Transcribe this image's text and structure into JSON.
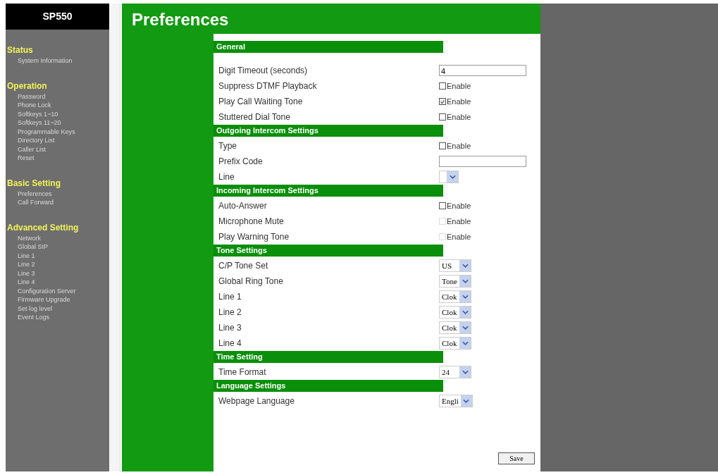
{
  "sidebar": {
    "logo": "SP550",
    "groups": [
      {
        "title": "Status",
        "items": [
          "System Information"
        ]
      },
      {
        "title": "Operation",
        "items": [
          "Password",
          "Phone Lock",
          "Softkeys 1~10",
          "Softkeys 11~20",
          "Programmable Keys",
          "Directory List",
          "Caller List",
          "Reset"
        ]
      },
      {
        "title": "Basic Setting",
        "items": [
          "Preferences",
          "Call Forward"
        ]
      },
      {
        "title": "Advanced Setting",
        "items": [
          "Network",
          "Global SIP",
          "Line 1",
          "Line 2",
          "Line 3",
          "Line 4",
          "Configuration Server",
          "Firmware Upgrade",
          "Set log level",
          "Event Logs"
        ]
      }
    ]
  },
  "page": {
    "title": "Preferences"
  },
  "sections": [
    {
      "title": "General",
      "rows": [
        {
          "kind": "text",
          "label": "Digit Timeout (seconds)",
          "value": "4"
        },
        {
          "kind": "checkbox",
          "label": "Suppress DTMF Playback",
          "option": "Enable",
          "checked": false,
          "disabled": false
        },
        {
          "kind": "checkbox",
          "label": "Play Call Waiting Tone",
          "option": "Enable",
          "checked": true,
          "disabled": false
        },
        {
          "kind": "checkbox",
          "label": "Stuttered Dial Tone",
          "option": "Enable",
          "checked": false,
          "disabled": false
        }
      ]
    },
    {
      "title": "Outgoing Intercom Settings",
      "rows": [
        {
          "kind": "checkbox",
          "label": "Type",
          "option": "Enable",
          "checked": false,
          "disabled": false
        },
        {
          "kind": "text",
          "label": "Prefix Code"
        },
        {
          "kind": "select",
          "label": "Line"
        }
      ]
    },
    {
      "title": "Incoming Intercom Settings",
      "rows": [
        {
          "kind": "checkbox",
          "label": "Auto-Answer",
          "option": "Enable",
          "checked": false,
          "disabled": false
        },
        {
          "kind": "checkbox",
          "label": "Microphone Mute",
          "option": "Enable",
          "checked": false,
          "disabled": true
        },
        {
          "kind": "checkbox",
          "label": "Play Warning Tone",
          "option": "Enable",
          "checked": false,
          "disabled": true
        }
      ]
    },
    {
      "title": "Tone Settings",
      "rows": [
        {
          "kind": "select",
          "label": "C/P Tone Set",
          "value": "US"
        },
        {
          "kind": "select",
          "label": "Global Ring Tone",
          "value": "Tone"
        },
        {
          "kind": "select",
          "label": "Line 1",
          "value": "Clok"
        },
        {
          "kind": "select",
          "label": "Line 2",
          "value": "Clok"
        },
        {
          "kind": "select",
          "label": "Line 3",
          "value": "Clok"
        },
        {
          "kind": "select",
          "label": "Line 4",
          "value": "Clok"
        }
      ]
    },
    {
      "title": "Time Setting",
      "rows": [
        {
          "kind": "select",
          "label": "Time Format",
          "value": "24"
        }
      ]
    },
    {
      "title": "Language Settings",
      "rows": [
        {
          "kind": "select",
          "label": "Webpage Language",
          "value": "Engli"
        }
      ]
    }
  ],
  "save_button": "Save"
}
